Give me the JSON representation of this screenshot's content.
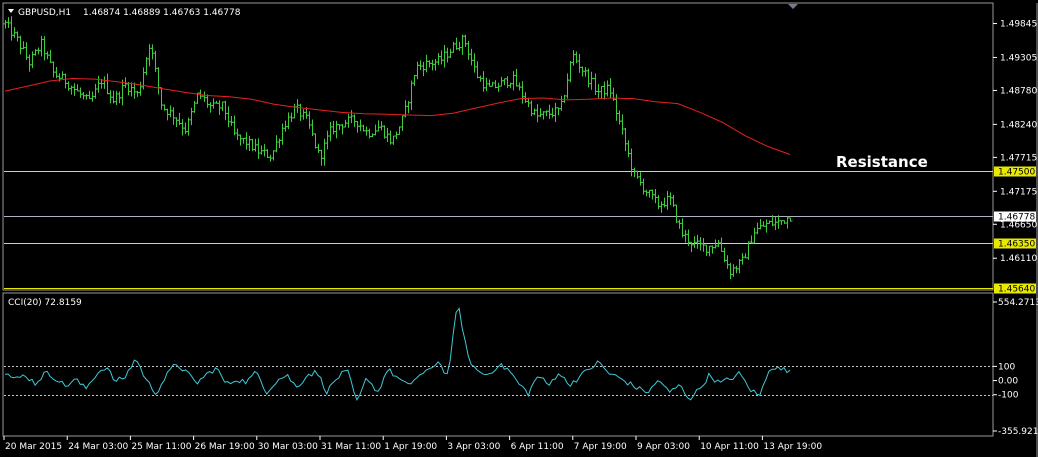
{
  "chart_data": [
    {
      "type": "line",
      "subtype": "ohlc-bars",
      "symbol_label": "GBPUSD,H1",
      "ohlc_header": "1.46874 1.46889 1.46763 1.46778",
      "ylim": [
        1.4562,
        1.5014
      ],
      "y_ticks": [
        "1.49845",
        "1.49305",
        "1.48780",
        "1.48240",
        "1.47715",
        "1.47175",
        "1.46650",
        "1.46110"
      ],
      "x_tick_labels": [
        "20 Mar 2015",
        "24 Mar 03:00",
        "25 Mar 11:00",
        "26 Mar 19:00",
        "30 Mar 03:00",
        "31 Mar 11:00",
        "1 Apr 19:00",
        "3 Apr 03:00",
        "6 Apr 11:00",
        "7 Apr 19:00",
        "9 Apr 03:00",
        "10 Apr 11:00",
        "13 Apr 19:00"
      ],
      "horizontal_levels": [
        {
          "value": 1.475,
          "label": "1.47500",
          "color": "#e8e800"
        },
        {
          "value": 1.4635,
          "label": "1.46350",
          "color": "#e8e800"
        },
        {
          "value": 1.4564,
          "label": "1.45640",
          "color": "#e8e800"
        }
      ],
      "current_price": {
        "value": 1.46778,
        "label": "1.46778",
        "color": "#b0b0c8"
      },
      "annotation": "Resistance",
      "price_path": [
        1.4984,
        1.4958,
        1.4922,
        1.4952,
        1.4905,
        1.4893,
        1.4875,
        1.4858,
        1.4895,
        1.4862,
        1.4888,
        1.4871,
        1.4955,
        1.4852,
        1.4838,
        1.4815,
        1.4873,
        1.4851,
        1.4852,
        1.4804,
        1.4795,
        1.478,
        1.4774,
        1.4822,
        1.485,
        1.4829,
        1.4771,
        1.4817,
        1.4827,
        1.4831,
        1.481,
        1.4821,
        1.4796,
        1.4836,
        1.4915,
        1.4921,
        1.4925,
        1.4945,
        1.496,
        1.4904,
        1.488,
        1.4888,
        1.4897,
        1.4866,
        1.4836,
        1.4841,
        1.4846,
        1.4935,
        1.4906,
        1.4876,
        1.4881,
        1.4814,
        1.4744,
        1.4719,
        1.4696,
        1.4705,
        1.465,
        1.4633,
        1.4628,
        1.4636,
        1.459,
        1.4605,
        1.4654,
        1.4665,
        1.4668,
        1.4678
      ],
      "sma_path": [
        1.4877,
        1.4885,
        1.4893,
        1.4897,
        1.4896,
        1.4892,
        1.4887,
        1.4881,
        1.4875,
        1.487,
        1.4868,
        1.4864,
        1.4856,
        1.4851,
        1.4847,
        1.4843,
        1.4841,
        1.484,
        1.4839,
        1.4838,
        1.4842,
        1.485,
        1.4858,
        1.4865,
        1.4866,
        1.4863,
        1.4864,
        1.4866,
        1.4865,
        1.486,
        1.4857,
        1.4843,
        1.4827,
        1.4806,
        1.4789,
        1.4776
      ],
      "sma_color": "#e82020",
      "bar_color": "#3ccc3c"
    },
    {
      "type": "line",
      "indicator_label": "CCI(20) 72.8159",
      "ylim": [
        -355.9219,
        554.2713
      ],
      "y_ticks": [
        "554.2713",
        "100",
        "0.00",
        "-100",
        "-355.9219"
      ],
      "levels": [
        100,
        -100
      ],
      "line_color": "#40c8d8",
      "anchor_values": [
        60,
        5,
        40,
        -20,
        55,
        20,
        -40,
        10,
        -60,
        40,
        100,
        -10,
        30,
        160,
        5,
        -90,
        30,
        120,
        60,
        -20,
        40,
        90,
        -30,
        10,
        -10,
        60,
        -80,
        0,
        40,
        -50,
        40,
        60,
        -80,
        20,
        70,
        -160,
        30,
        -90,
        80,
        20,
        -40,
        30,
        60,
        140,
        30,
        554,
        160,
        60,
        40,
        110,
        80,
        -20,
        -90,
        40,
        -40,
        60,
        -30,
        20,
        80,
        130,
        50,
        20,
        -20,
        -60,
        -80,
        10,
        -90,
        -30,
        -130,
        -60,
        40,
        -20,
        10,
        50,
        -60,
        -110,
        100,
        80,
        72.8159
      ]
    }
  ]
}
